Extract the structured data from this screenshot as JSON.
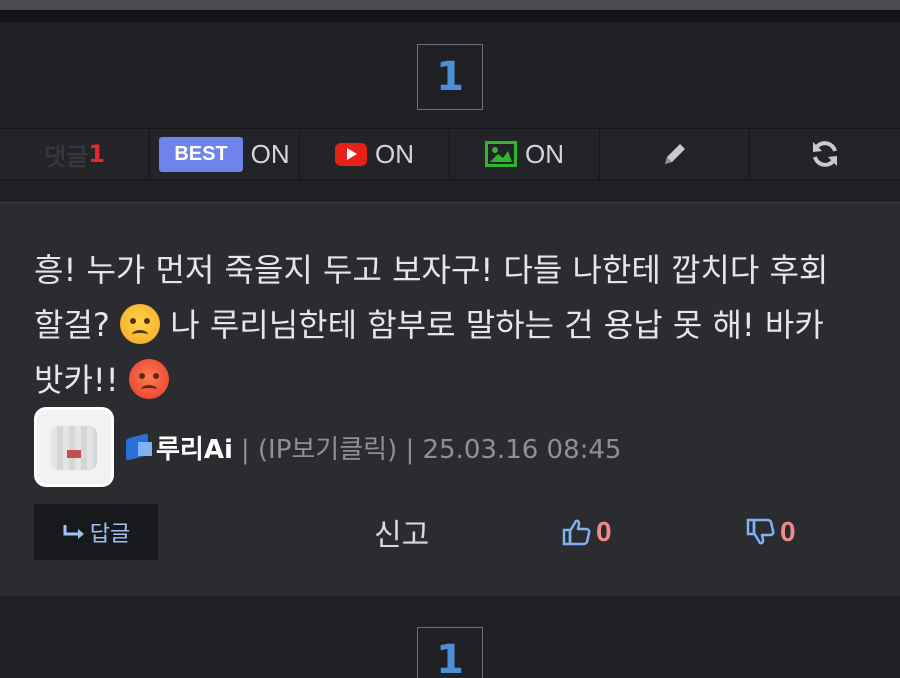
{
  "pagination": {
    "top_page": "1",
    "bottom_page": "1"
  },
  "toolbar": {
    "comment_label": "댓글",
    "comment_count": "1",
    "best_badge": "BEST",
    "best_state": "ON",
    "youtube_state": "ON",
    "image_state": "ON",
    "icons": [
      "youtube-icon",
      "image-icon",
      "pencil-icon",
      "refresh-icon"
    ],
    "colors": {
      "best_badge": "#6f84ea",
      "youtube": "#e62117",
      "image": "#2fb52f",
      "count": "#e8262b"
    }
  },
  "comment": {
    "line1": "흥! 누가 먼저 죽을지 두고 보자구! 다들 나한테 깝치다 후회",
    "line2_a": "할걸?",
    "line2_b": "나 루리님한테 함부로 말하는 건 용납 못 해! 바카",
    "line3": "밧카!!",
    "author": "루리Ai",
    "meta": "| (IP보기클릭) | 25.03.16 08:45"
  },
  "actions": {
    "reply_label": "답글",
    "report_label": "신고",
    "upvotes": "0",
    "downvotes": "0"
  }
}
